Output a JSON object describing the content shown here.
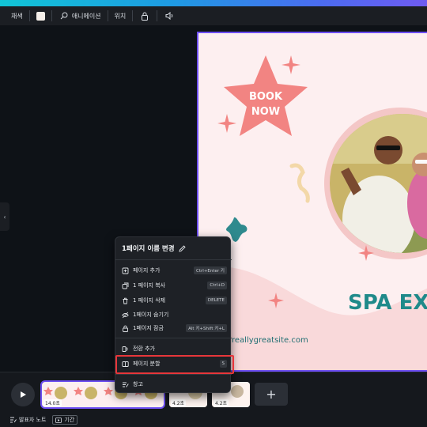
{
  "toolbar": {
    "color_label": "채색",
    "animation_label": "애니메이션",
    "position_label": "위치"
  },
  "canvas": {
    "badge_text_line1": "BOOK",
    "badge_text_line2": "NOW",
    "headline": "SPA EX",
    "website": "reallygreatsite.com"
  },
  "context_menu": {
    "title": "1페이지 이름 변경",
    "items": [
      {
        "label": "페이지 추가",
        "shortcut": "Ctrl+Enter 키"
      },
      {
        "label": "1 페이지 복사",
        "shortcut": "Ctrl+D"
      },
      {
        "label": "1 페이지 삭제",
        "shortcut": "DELETE"
      },
      {
        "label": "1페이지 숨기기",
        "shortcut": ""
      },
      {
        "label": "1페이지 잠금",
        "shortcut": "Alt 키+Shift 키+L"
      },
      {
        "label": "전환 추가",
        "shortcut": ""
      },
      {
        "label": "페이지 분할",
        "shortcut": "S"
      },
      {
        "label": "창고",
        "shortcut": ""
      }
    ]
  },
  "timeline": {
    "page1_duration": "14.0초",
    "page2_duration": "4.2초",
    "page3_duration": "4.2초",
    "add_label": "+"
  },
  "status_bar": {
    "notes_label": "발표자 노트",
    "timer_label": "기간"
  },
  "colors": {
    "accent": "#6d4ef2",
    "highlight": "#e8363a",
    "canvas_bg": "#fdeff0",
    "star": "#f28482",
    "teal": "#1f8a8a"
  }
}
